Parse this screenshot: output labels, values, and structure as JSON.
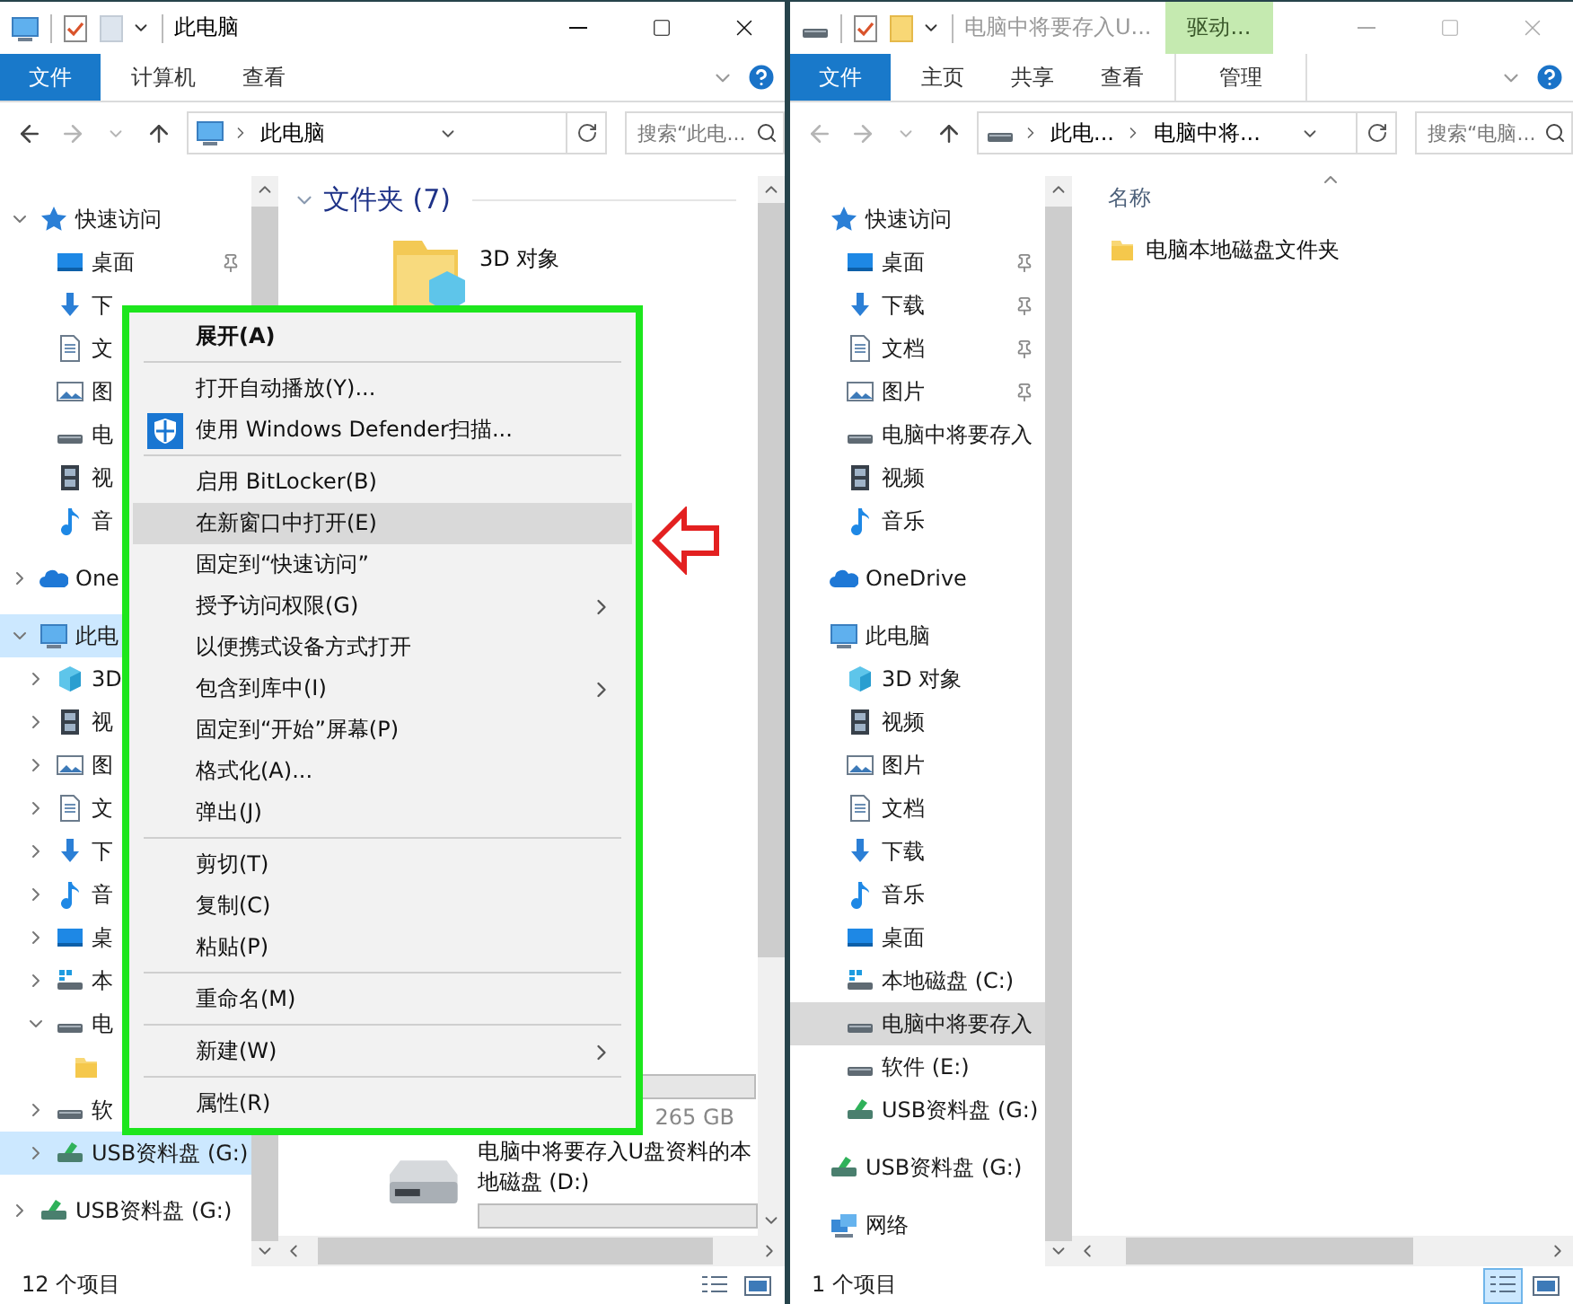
{
  "left_window": {
    "active": true,
    "kind": "computer",
    "title": "此电脑",
    "ribbon_tabs": [
      {
        "label": "文件",
        "kind": "file"
      },
      {
        "label": "计算机",
        "kind": "tab"
      },
      {
        "label": "查看",
        "kind": "tab"
      }
    ],
    "address": {
      "crumbs": [
        "此电脑"
      ]
    },
    "search": {
      "placeholder": "搜索“此电..."
    },
    "nav": [
      {
        "label": "快速访问",
        "kind": "star",
        "expanded": true,
        "selected": false,
        "children": [
          {
            "label": "桌面",
            "kind": "desktop",
            "pinned": true,
            "selected": false
          },
          {
            "label": "下",
            "kind": "download",
            "pinned": false,
            "selected": false
          },
          {
            "label": "文",
            "kind": "document",
            "pinned": false,
            "selected": false
          },
          {
            "label": "图",
            "kind": "picture",
            "pinned": false,
            "selected": false
          },
          {
            "label": "电",
            "kind": "drive",
            "pinned": false,
            "selected": false
          },
          {
            "label": "视",
            "kind": "video",
            "pinned": false,
            "selected": false
          },
          {
            "label": "音",
            "kind": "music",
            "pinned": false,
            "selected": false
          }
        ]
      },
      {
        "label": "One",
        "kind": "cloud",
        "expanded": false,
        "selected": false
      },
      {
        "label": "此电",
        "kind": "computer",
        "expanded": true,
        "selected": true,
        "children": [
          {
            "label": "3D",
            "kind": "cube",
            "expanded": false,
            "selected": false
          },
          {
            "label": "视",
            "kind": "video",
            "expanded": false,
            "selected": false
          },
          {
            "label": "图",
            "kind": "picture",
            "expanded": false,
            "selected": false
          },
          {
            "label": "文",
            "kind": "document",
            "expanded": false,
            "selected": false
          },
          {
            "label": "下",
            "kind": "download",
            "expanded": false,
            "selected": false
          },
          {
            "label": "音",
            "kind": "music",
            "expanded": false,
            "selected": false
          },
          {
            "label": "桌",
            "kind": "desktop",
            "expanded": false,
            "selected": false
          },
          {
            "label": "本",
            "kind": "system-drive",
            "expanded": false,
            "selected": false
          },
          {
            "label": "电",
            "kind": "drive",
            "expanded": true,
            "selected": false,
            "children": [
              {
                "kind": "folder",
                "selected": false
              }
            ]
          },
          {
            "label": "软",
            "kind": "drive",
            "expanded": false,
            "selected": false
          },
          {
            "label": "USB资料盘 (G:)",
            "kind": "usb",
            "expanded": false,
            "selected": true
          }
        ]
      },
      {
        "label": "USB资料盘 (G:)",
        "kind": "usb",
        "expanded": false,
        "selected": false
      }
    ],
    "content": {
      "kind": "tiles",
      "group": "文件夹 (7)",
      "folders": [
        {
          "label": "3D 对象"
        }
      ],
      "drives": [
        {
          "size": "265 GB"
        },
        {
          "name": "电脑中将要存入U盘资料的本地磁盘 (D:)"
        }
      ]
    },
    "status": "12 个项目",
    "views": [
      {
        "selected": false
      },
      {
        "selected": false
      }
    ]
  },
  "right_window": {
    "active": false,
    "kind": "drive",
    "title": "电脑中将要存入U...",
    "contextual_tab": "驱动...",
    "ribbon_tabs": [
      {
        "label": "文件",
        "kind": "file"
      },
      {
        "label": "主页",
        "kind": "tab"
      },
      {
        "label": "共享",
        "kind": "tab"
      },
      {
        "label": "查看",
        "kind": "tab"
      },
      {
        "label": "管理",
        "kind": "contextual"
      }
    ],
    "address": {
      "crumbs": [
        "此电...",
        "电脑中将..."
      ]
    },
    "search": {
      "placeholder": "搜索“电脑..."
    },
    "nav": [
      {
        "label": "快速访问",
        "kind": "star",
        "selected": false,
        "children": [
          {
            "label": "桌面",
            "kind": "desktop",
            "pinned": true,
            "selected": false
          },
          {
            "label": "下载",
            "kind": "download",
            "pinned": true,
            "selected": false
          },
          {
            "label": "文档",
            "kind": "document",
            "pinned": true,
            "selected": false
          },
          {
            "label": "图片",
            "kind": "picture",
            "pinned": true,
            "selected": false
          },
          {
            "label": "电脑中将要存入",
            "kind": "drive",
            "pinned": false,
            "selected": false
          },
          {
            "label": "视频",
            "kind": "video",
            "pinned": false,
            "selected": false
          },
          {
            "label": "音乐",
            "kind": "music",
            "pinned": false,
            "selected": false
          }
        ]
      },
      {
        "label": "OneDrive",
        "kind": "cloud",
        "selected": false
      },
      {
        "label": "此电脑",
        "kind": "computer",
        "selected": false,
        "children": [
          {
            "label": "3D 对象",
            "kind": "cube",
            "selected": false
          },
          {
            "label": "视频",
            "kind": "video",
            "selected": false
          },
          {
            "label": "图片",
            "kind": "picture",
            "selected": false
          },
          {
            "label": "文档",
            "kind": "document",
            "selected": false
          },
          {
            "label": "下载",
            "kind": "download",
            "selected": false
          },
          {
            "label": "音乐",
            "kind": "music",
            "selected": false
          },
          {
            "label": "桌面",
            "kind": "desktop",
            "selected": false
          },
          {
            "label": "本地磁盘 (C:)",
            "kind": "system-drive",
            "selected": false
          },
          {
            "label": "电脑中将要存入",
            "kind": "drive",
            "selected": true
          },
          {
            "label": "软件 (E:)",
            "kind": "drive",
            "selected": false
          },
          {
            "label": "USB资料盘 (G:)",
            "kind": "usb",
            "selected": false
          }
        ]
      },
      {
        "label": "USB资料盘 (G:)",
        "kind": "usb",
        "selected": false
      },
      {
        "label": "网络",
        "kind": "network",
        "selected": false
      }
    ],
    "content": {
      "kind": "details",
      "column": "名称",
      "rows": [
        {
          "label": "电脑本地磁盘文件夹"
        }
      ]
    },
    "status": "1 个项目",
    "views": [
      {
        "selected": true
      },
      {
        "selected": false
      }
    ]
  },
  "context_menu": {
    "items": [
      {
        "kind": "item",
        "label": "展开(A)",
        "default": true,
        "submenu": false,
        "selected": false
      },
      {
        "kind": "separator"
      },
      {
        "kind": "item",
        "label": "打开自动播放(Y)...",
        "default": false,
        "submenu": false,
        "selected": false
      },
      {
        "kind": "scan",
        "label": "使用 Windows Defender扫描...",
        "default": false,
        "submenu": false,
        "selected": false
      },
      {
        "kind": "separator"
      },
      {
        "kind": "item",
        "label": "启用 BitLocker(B)",
        "default": false,
        "submenu": false,
        "selected": false
      },
      {
        "kind": "item",
        "label": "在新窗口中打开(E)",
        "default": false,
        "submenu": false,
        "selected": true
      },
      {
        "kind": "item",
        "label": "固定到“快速访问”",
        "default": false,
        "submenu": false,
        "selected": false
      },
      {
        "kind": "item",
        "label": "授予访问权限(G)",
        "default": false,
        "submenu": true,
        "selected": false
      },
      {
        "kind": "item",
        "label": "以便携式设备方式打开",
        "default": false,
        "submenu": false,
        "selected": false
      },
      {
        "kind": "item",
        "label": "包含到库中(I)",
        "default": false,
        "submenu": true,
        "selected": false
      },
      {
        "kind": "item",
        "label": "固定到“开始”屏幕(P)",
        "default": false,
        "submenu": false,
        "selected": false
      },
      {
        "kind": "item",
        "label": "格式化(A)...",
        "default": false,
        "submenu": false,
        "selected": false
      },
      {
        "kind": "item",
        "label": "弹出(J)",
        "default": false,
        "submenu": false,
        "selected": false
      },
      {
        "kind": "separator"
      },
      {
        "kind": "item",
        "label": "剪切(T)",
        "default": false,
        "submenu": false,
        "selected": false
      },
      {
        "kind": "item",
        "label": "复制(C)",
        "default": false,
        "submenu": false,
        "selected": false
      },
      {
        "kind": "item",
        "label": "粘贴(P)",
        "default": false,
        "submenu": false,
        "selected": false
      },
      {
        "kind": "separator"
      },
      {
        "kind": "item",
        "label": "重命名(M)",
        "default": false,
        "submenu": false,
        "selected": false
      },
      {
        "kind": "separator"
      },
      {
        "kind": "item",
        "label": "新建(W)",
        "default": false,
        "submenu": true,
        "selected": false
      },
      {
        "kind": "separator"
      },
      {
        "kind": "item",
        "label": "属性(R)",
        "default": false,
        "submenu": false,
        "selected": false
      }
    ]
  }
}
